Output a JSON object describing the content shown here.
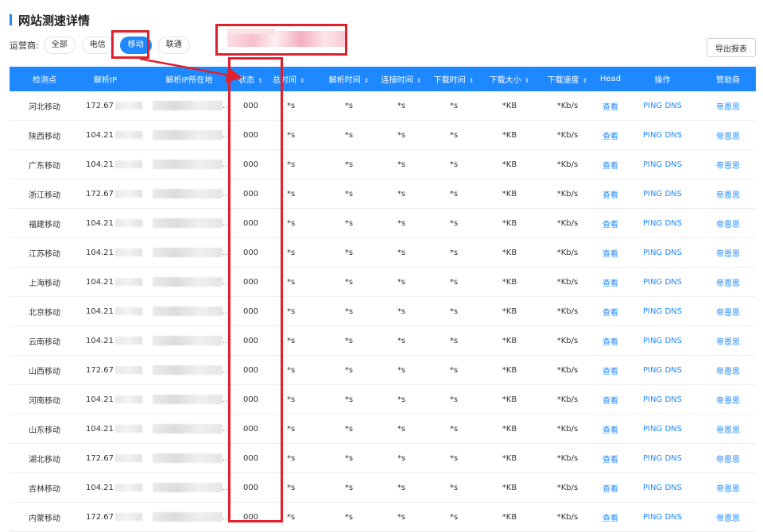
{
  "page": {
    "title": "网站测速详情"
  },
  "filters": {
    "label": "运营商:",
    "options": [
      "全部",
      "电信",
      "移动",
      "联通"
    ],
    "active_index": 2
  },
  "search": {
    "value": ""
  },
  "toolbar": {
    "export_label": "导出报表"
  },
  "table": {
    "columns": [
      "检测点",
      "解析IP",
      "解析IP所在地",
      "状态",
      "总时间",
      "解析时间",
      "连接时间",
      "下载时间",
      "下载大小",
      "下载速度",
      "Head",
      "操作",
      "赞助商"
    ],
    "sortable": [
      false,
      false,
      false,
      true,
      true,
      true,
      true,
      true,
      true,
      true,
      false,
      false,
      false
    ],
    "row_template": {
      "status": "000",
      "total_time": "*s",
      "resolve_time": "*s",
      "connect_time": "*s",
      "download_time": "*s",
      "download_size": "*KB",
      "download_speed": "*Kb/s",
      "head_link": "查看",
      "ping_link": "PING",
      "dns_link": "DNS",
      "sponsor": "帝恩思",
      "loc_suffix": ".."
    },
    "rows": [
      {
        "node": "河北移动",
        "ip": "172.67"
      },
      {
        "node": "陕西移动",
        "ip": "104.21"
      },
      {
        "node": "广东移动",
        "ip": "104.21"
      },
      {
        "node": "浙江移动",
        "ip": "172.67"
      },
      {
        "node": "福建移动",
        "ip": "104.21"
      },
      {
        "node": "江苏移动",
        "ip": "104.21"
      },
      {
        "node": "上海移动",
        "ip": "104.21"
      },
      {
        "node": "北京移动",
        "ip": "104.21"
      },
      {
        "node": "云南移动",
        "ip": "104.21"
      },
      {
        "node": "山西移动",
        "ip": "172.67"
      },
      {
        "node": "河南移动",
        "ip": "104.21"
      },
      {
        "node": "山东移动",
        "ip": "104.21"
      },
      {
        "node": "湖北移动",
        "ip": "172.67"
      },
      {
        "node": "吉林移动",
        "ip": "104.21"
      },
      {
        "node": "内蒙移动",
        "ip": "172.67"
      }
    ]
  },
  "colors": {
    "accent": "#1e88ff",
    "annotation": "#e0202a"
  }
}
